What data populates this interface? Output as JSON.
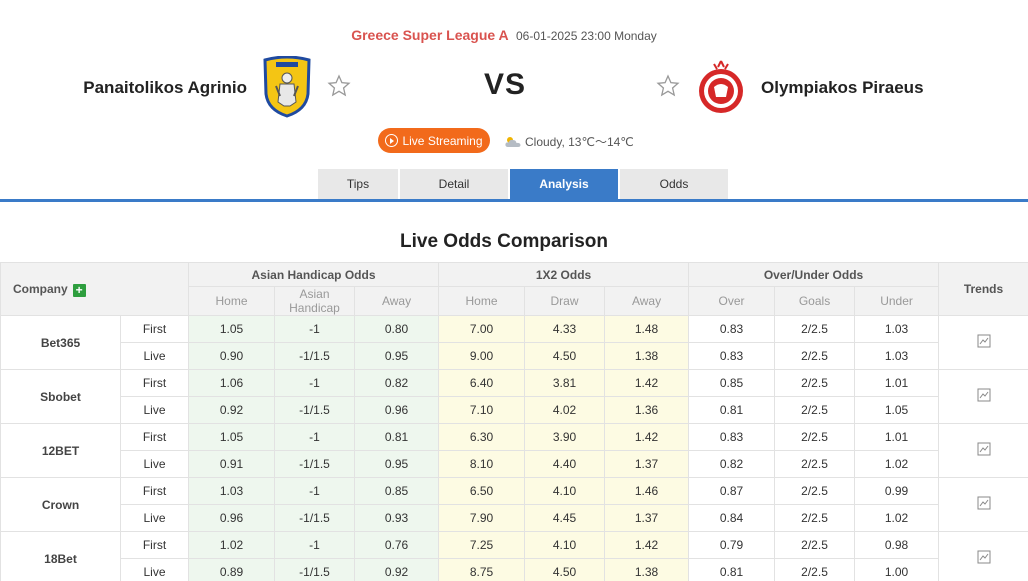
{
  "match": {
    "league": "Greece Super League A",
    "datetime": "06-01-2025 23:00 Monday",
    "home_team": "Panaitolikos Agrinio",
    "away_team": "Olympiakos Piraeus",
    "vs": "VS",
    "live_label": "Live Streaming",
    "weather": "Cloudy, 13℃～14℃"
  },
  "tabs": [
    {
      "label": "Tips"
    },
    {
      "label": "Detail"
    },
    {
      "label": "Analysis",
      "active": true
    },
    {
      "label": "Odds"
    }
  ],
  "section_title": "Live Odds Comparison",
  "table": {
    "company_header": "Company",
    "trends_header": "Trends",
    "groups": [
      "Asian Handicap Odds",
      "1X2 Odds",
      "Over/Under Odds"
    ],
    "sub_headers": [
      "Home",
      "Asian Handicap",
      "Away",
      "Home",
      "Draw",
      "Away",
      "Over",
      "Goals",
      "Under"
    ],
    "companies": [
      {
        "name": "Bet365",
        "rows": [
          {
            "type": "First",
            "vals": [
              "1.05",
              "-1",
              "0.80",
              "7.00",
              "4.33",
              "1.48",
              "0.83",
              "2/2.5",
              "1.03"
            ]
          },
          {
            "type": "Live",
            "vals": [
              "0.90",
              "-1/1.5",
              "0.95",
              "9.00",
              "4.50",
              "1.38",
              "0.83",
              "2/2.5",
              "1.03"
            ]
          }
        ]
      },
      {
        "name": "Sbobet",
        "rows": [
          {
            "type": "First",
            "vals": [
              "1.06",
              "-1",
              "0.82",
              "6.40",
              "3.81",
              "1.42",
              "0.85",
              "2/2.5",
              "1.01"
            ]
          },
          {
            "type": "Live",
            "vals": [
              "0.92",
              "-1/1.5",
              "0.96",
              "7.10",
              "4.02",
              "1.36",
              "0.81",
              "2/2.5",
              "1.05"
            ]
          }
        ]
      },
      {
        "name": "12BET",
        "rows": [
          {
            "type": "First",
            "vals": [
              "1.05",
              "-1",
              "0.81",
              "6.30",
              "3.90",
              "1.42",
              "0.83",
              "2/2.5",
              "1.01"
            ]
          },
          {
            "type": "Live",
            "vals": [
              "0.91",
              "-1/1.5",
              "0.95",
              "8.10",
              "4.40",
              "1.37",
              "0.82",
              "2/2.5",
              "1.02"
            ]
          }
        ]
      },
      {
        "name": "Crown",
        "rows": [
          {
            "type": "First",
            "vals": [
              "1.03",
              "-1",
              "0.85",
              "6.50",
              "4.10",
              "1.46",
              "0.87",
              "2/2.5",
              "0.99"
            ]
          },
          {
            "type": "Live",
            "vals": [
              "0.96",
              "-1/1.5",
              "0.93",
              "7.90",
              "4.45",
              "1.37",
              "0.84",
              "2/2.5",
              "1.02"
            ]
          }
        ]
      },
      {
        "name": "18Bet",
        "rows": [
          {
            "type": "First",
            "vals": [
              "1.02",
              "-1",
              "0.76",
              "7.25",
              "4.10",
              "1.42",
              "0.79",
              "2/2.5",
              "0.98"
            ]
          },
          {
            "type": "Live",
            "vals": [
              "0.89",
              "-1/1.5",
              "0.92",
              "8.75",
              "4.50",
              "1.38",
              "0.81",
              "2/2.5",
              "1.00"
            ]
          }
        ]
      }
    ]
  },
  "colors": {
    "accent_blue": "#3a7bc8",
    "live_orange": "#f26a1b",
    "league_red": "#d9534f",
    "ah_bg": "#eef7ee",
    "x12_bg": "#fdfbe3"
  }
}
